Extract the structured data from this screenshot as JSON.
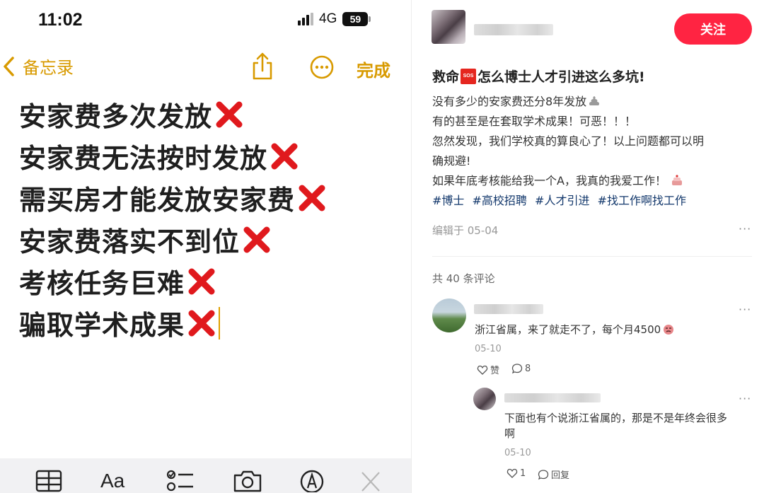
{
  "status_bar": {
    "time": "11:02",
    "network": "4G",
    "battery": "59"
  },
  "notes_nav": {
    "back_label": "备忘录",
    "done_label": "完成"
  },
  "note_lines": [
    "安家费多次发放",
    "安家费无法按时发放",
    "需买房才能发放安家费",
    "安家费落实不到位",
    "考核任务巨难",
    "骗取学术成果"
  ],
  "notes_toolbar": {
    "format_label": "Aa"
  },
  "post": {
    "follow_label": "关注",
    "title_prefix": "救命",
    "title_badge": "SOS",
    "title_rest": "怎么博士人才引进这么多坑!",
    "body": [
      "没有多少的安家费还分8年发放",
      "有的甚至是在套取学术成果！可恶！！！",
      "忽然发现，我们学校真的算良心了！以上问题都可以明",
      "确规避!",
      "如果年底考核能给我一个A，我真的我爱工作！"
    ],
    "tags": [
      "#博士",
      "#高校招聘",
      "#人才引进",
      "#找工作啊找工作"
    ],
    "edit_date": "编辑于 05-04",
    "more": "···",
    "comment_count": "共 40 条评论"
  },
  "comments": [
    {
      "text": "浙江省属，来了就走不了，每个月4500",
      "date": "05-10",
      "like_label": "赞",
      "reply_count": "8",
      "more": "···"
    },
    {
      "text_line1": "下面也有个说浙江省属的，那是不是年终会很多",
      "text_line2": "啊",
      "date": "05-10",
      "like_count": "1",
      "reply_label": "回复",
      "more": "···"
    }
  ],
  "colors": {
    "notes_accent": "#d89a00",
    "follow_red": "#ff2442",
    "tag_blue": "#13386c",
    "x_red": "#e0191d"
  }
}
